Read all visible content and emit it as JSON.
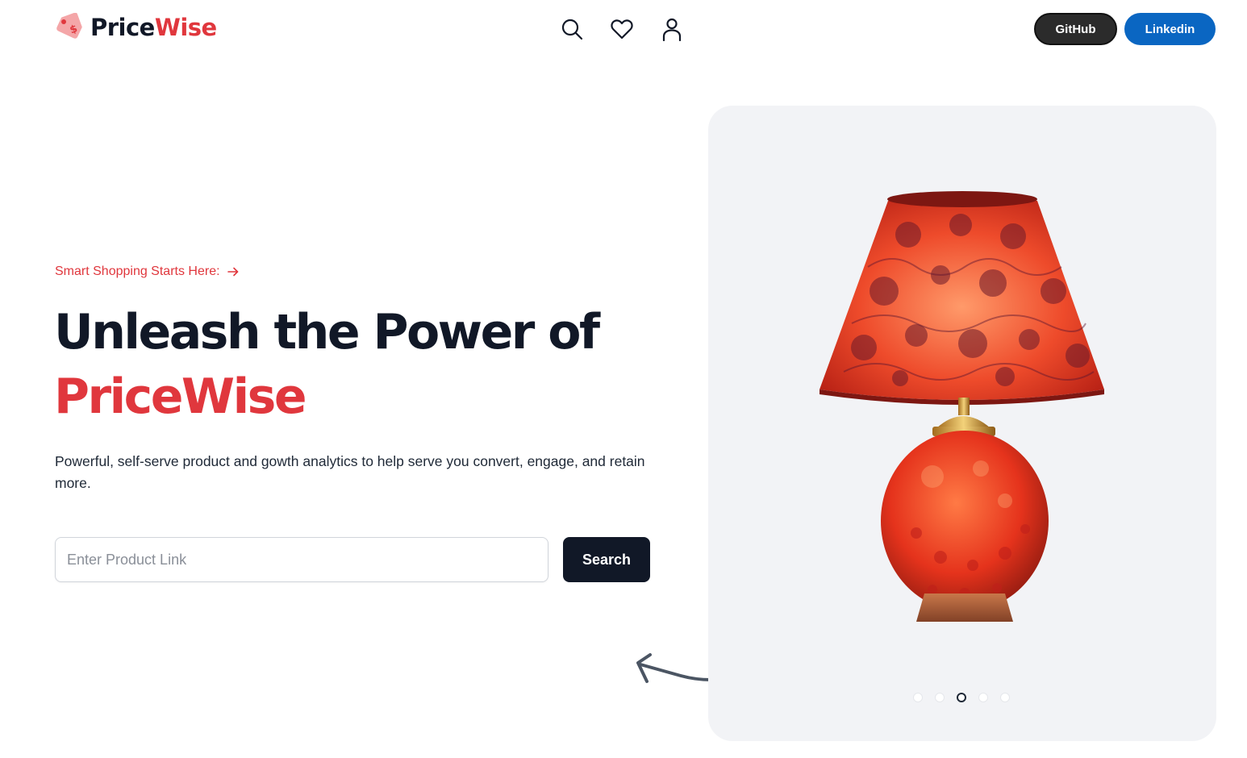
{
  "header": {
    "logo_main": "Price",
    "logo_accent": "Wise",
    "logo_icon": "price-tag-icon",
    "nav_icons": [
      "search-icon",
      "heart-icon",
      "user-icon"
    ],
    "github_label": "GitHub",
    "linkedin_label": "Linkedin"
  },
  "hero": {
    "tagline": "Smart Shopping Starts Here:",
    "headline": "Unleash the Power of",
    "headline_accent": "PriceWise",
    "subtext": "Powerful, self-serve product and gowth analytics to help serve you convert, engage, and retain more.",
    "search": {
      "placeholder": "Enter Product Link",
      "value": "",
      "button_label": "Search"
    }
  },
  "carousel": {
    "slide_count": 5,
    "active_index": 2,
    "image": "red-table-lamp"
  },
  "colors": {
    "accent": "#e0373d",
    "dark": "#111827",
    "github": "#2b2b2b",
    "linkedin": "#0a66c2",
    "carousel_bg": "#f2f3f6"
  }
}
